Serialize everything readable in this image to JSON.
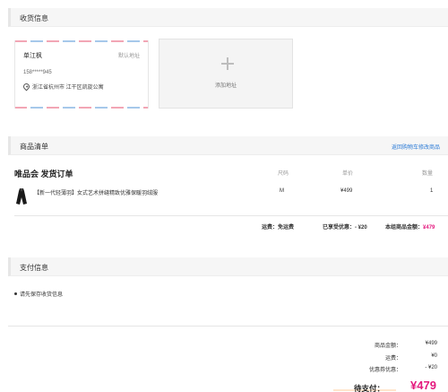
{
  "shipping": {
    "title": "收货信息",
    "address": {
      "name": "单江枫",
      "default_label": "默认地址",
      "phone": "158*****945",
      "location": "浙江省杭州市 江干区凯旋公寓"
    },
    "add_label": "添加地址"
  },
  "goods": {
    "title": "商品清单",
    "back_link": "返回购物车修改商品",
    "shop_name": "唯品会 发货订单",
    "columns": [
      "尺码",
      "单价",
      "数量"
    ],
    "item": {
      "name": "【新一代轻薄羽】女式艺术拼缝精致优雅保暖羽绒服",
      "size": "M",
      "price": "¥499",
      "qty": "1"
    },
    "summary": {
      "shipping_label": "运费：",
      "shipping_value": "免运费",
      "discount_label": "已享受优惠：",
      "discount_value": "- ¥20",
      "subtotal_label": "本组商品金额：",
      "subtotal_value": "¥479"
    }
  },
  "payment": {
    "title": "支付信息",
    "note": "请先保存收货信息",
    "rows": [
      {
        "label": "商品金额：",
        "value": "¥499"
      },
      {
        "label": "运费：",
        "value": "¥0"
      },
      {
        "label": "优惠券优惠：",
        "value": "- ¥20"
      }
    ],
    "total_label": "待支付：",
    "total_value": "¥479"
  },
  "colors": {
    "accent": "#e4197e",
    "link": "#2b7bd6"
  }
}
